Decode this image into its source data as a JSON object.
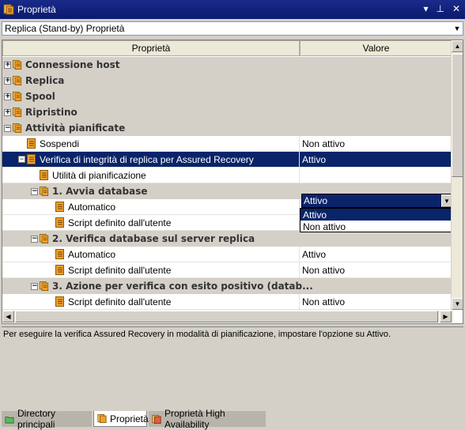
{
  "window": {
    "title": "Proprietà"
  },
  "title_buttons": {
    "menu": "▾",
    "pin": "📌",
    "close": "✕"
  },
  "combo": {
    "value": "Replica (Stand-by)  Proprietà"
  },
  "grid": {
    "col_property": "Proprietà",
    "col_value": "Valore",
    "rows": [
      {
        "type": "cat",
        "level": 0,
        "expander": "+",
        "label": "Connessione host",
        "value": ""
      },
      {
        "type": "cat",
        "level": 0,
        "expander": "+",
        "label": "Replica",
        "value": ""
      },
      {
        "type": "cat",
        "level": 0,
        "expander": "+",
        "label": "Spool",
        "value": ""
      },
      {
        "type": "cat",
        "level": 0,
        "expander": "+",
        "label": "Ripristino",
        "value": ""
      },
      {
        "type": "cat",
        "level": 0,
        "expander": "−",
        "label": "Attività pianificate",
        "value": ""
      },
      {
        "type": "prop",
        "level": 1,
        "expander": "",
        "label": "Sospendi",
        "value": "Non attivo"
      },
      {
        "type": "prop",
        "level": 1,
        "expander": "−",
        "label": "Verifica di integrità di replica per Assured Recovery",
        "value": "Attivo",
        "selected": true
      },
      {
        "type": "prop",
        "level": 2,
        "expander": "",
        "label": "Utilità di pianificazione",
        "value": ""
      },
      {
        "type": "cat",
        "level": 2,
        "expander": "−",
        "label": "1. Avvia database",
        "value": ""
      },
      {
        "type": "prop",
        "level": 3,
        "expander": "",
        "label": "Automatico",
        "value": "Attivo"
      },
      {
        "type": "prop",
        "level": 3,
        "expander": "",
        "label": "Script definito dall'utente",
        "value": "Non attivo"
      },
      {
        "type": "cat",
        "level": 2,
        "expander": "−",
        "label": "2. Verifica database sul server replica",
        "value": ""
      },
      {
        "type": "prop",
        "level": 3,
        "expander": "",
        "label": "Automatico",
        "value": "Attivo"
      },
      {
        "type": "prop",
        "level": 3,
        "expander": "",
        "label": "Script definito dall'utente",
        "value": "Non attivo"
      },
      {
        "type": "cat",
        "level": 2,
        "expander": "−",
        "label": "3. Azione per verifica con esito positivo (datab...",
        "value": ""
      },
      {
        "type": "prop",
        "level": 3,
        "expander": "",
        "label": "Script definito dall'utente",
        "value": "Non attivo"
      }
    ]
  },
  "dropdown": {
    "current": "Attivo",
    "options": [
      "Attivo",
      "Non attivo"
    ],
    "highlighted": "Attivo"
  },
  "description": "Per eseguire la verifica Assured Recovery in modalità di pianificazione, impostare l'opzione su Attivo.",
  "tabs": [
    {
      "label": "Directory principali",
      "icon": "folder-icon",
      "active": false
    },
    {
      "label": "Proprietà",
      "icon": "properties-icon",
      "active": true
    },
    {
      "label": "Proprietà High Availability",
      "icon": "ha-properties-icon",
      "active": false
    }
  ],
  "colors": {
    "title_bar": "#0a246a",
    "selection": "#0a246a",
    "icon_orange": "#f0a030",
    "panel": "#d4d0c8"
  }
}
